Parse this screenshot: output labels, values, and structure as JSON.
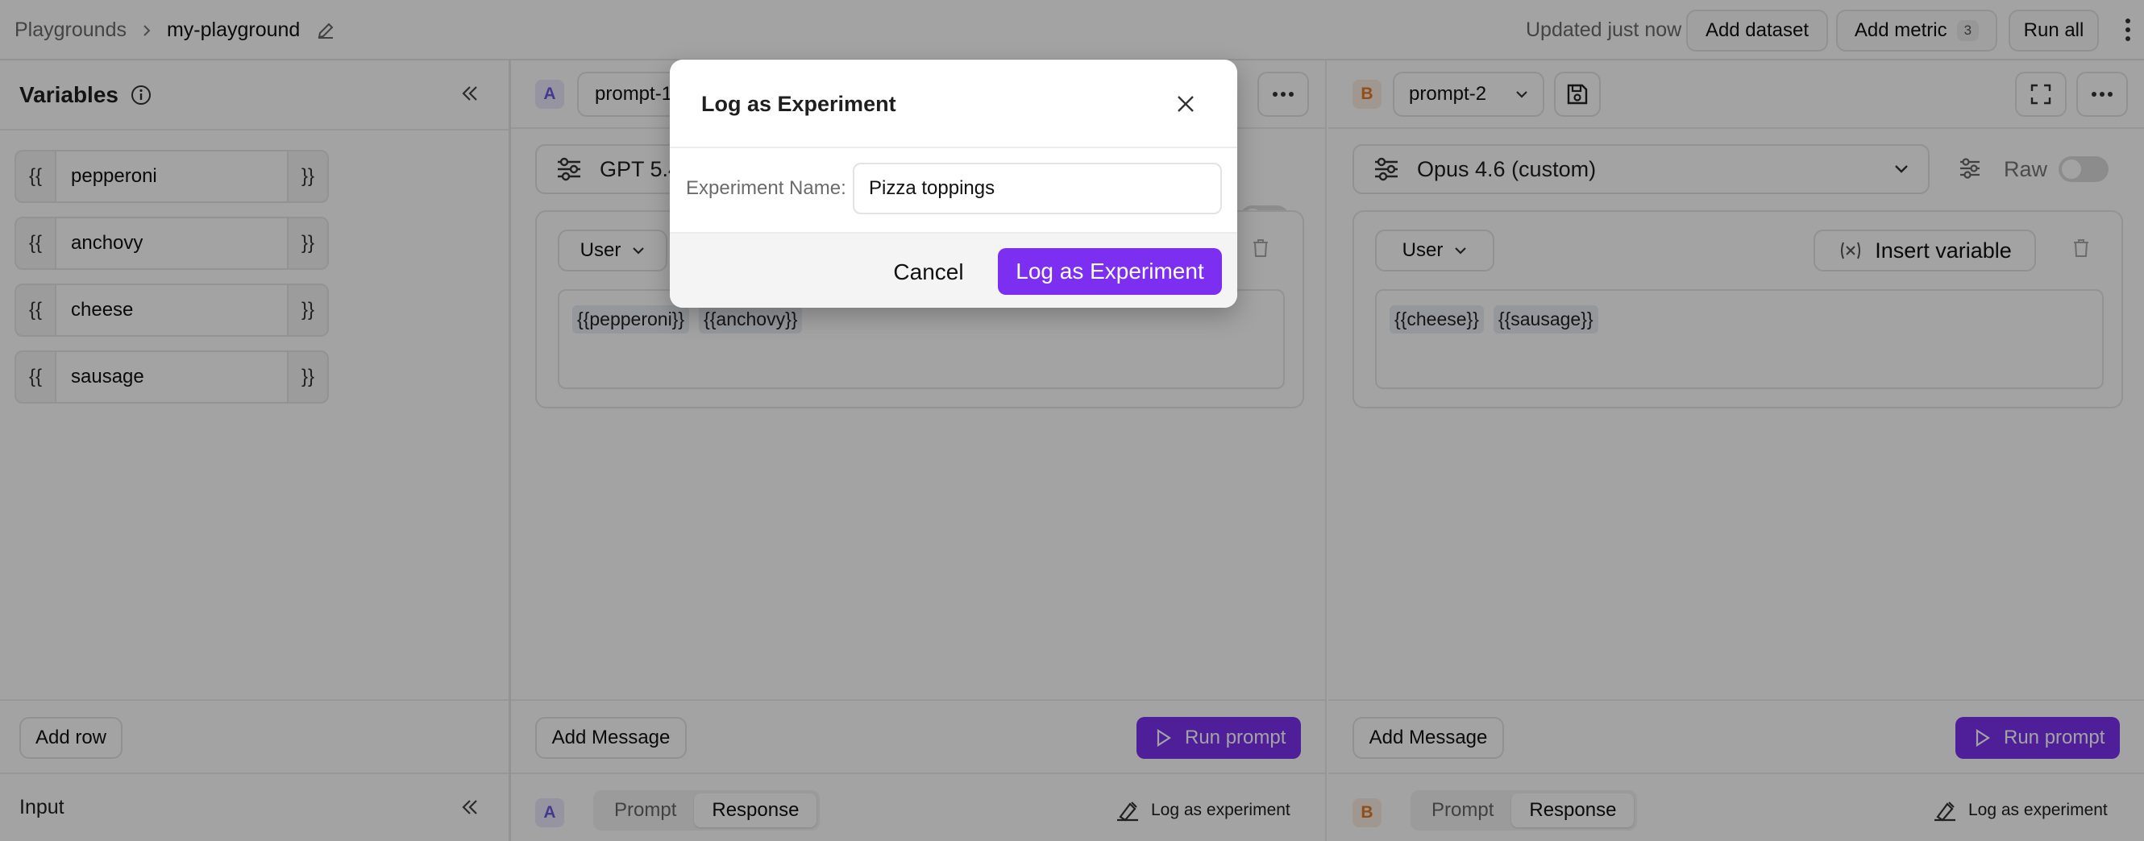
{
  "breadcrumb": {
    "root": "Playgrounds",
    "separator": "›",
    "current": "my-playground"
  },
  "topbar": {
    "status": "Updated just now",
    "add_dataset": "Add dataset",
    "add_metric": "Add metric",
    "metric_count": "3",
    "run_all": "Run all"
  },
  "variables": {
    "title": "Variables",
    "open_brace": "{{",
    "close_brace": "}}",
    "items": [
      "pepperoni",
      "anchovy",
      "cheese",
      "sausage"
    ],
    "add_row": "Add row",
    "input_label": "Input"
  },
  "pane_a": {
    "letter": "A",
    "prompt_name": "prompt-1",
    "model": "GPT 5.4",
    "role": "User",
    "chips": [
      "{{pepperoni}}",
      "{{anchovy}}"
    ],
    "add_message": "Add Message",
    "run_prompt": "Run prompt",
    "tabs": [
      "Prompt",
      "Response"
    ],
    "active_tab": "Response",
    "log_as_experiment": "Log as experiment"
  },
  "pane_b": {
    "letter": "B",
    "prompt_name": "prompt-2",
    "model": "Opus 4.6 (custom)",
    "raw_label": "Raw",
    "role": "User",
    "insert_variable": "Insert variable",
    "chips": [
      "{{cheese}}",
      "{{sausage}}"
    ],
    "add_message": "Add Message",
    "run_prompt": "Run prompt",
    "tabs": [
      "Prompt",
      "Response"
    ],
    "active_tab": "Response",
    "log_as_experiment": "Log as experiment"
  },
  "modal": {
    "title": "Log as Experiment",
    "field_label": "Experiment Name:",
    "field_value": "Pizza toppings",
    "cancel": "Cancel",
    "confirm": "Log as Experiment"
  },
  "colors": {
    "accent": "#7c2ff0",
    "badge_a": "#6a5ae0",
    "badge_b": "#e07a2a",
    "overlay": "rgba(0,0,0,0.36)"
  }
}
